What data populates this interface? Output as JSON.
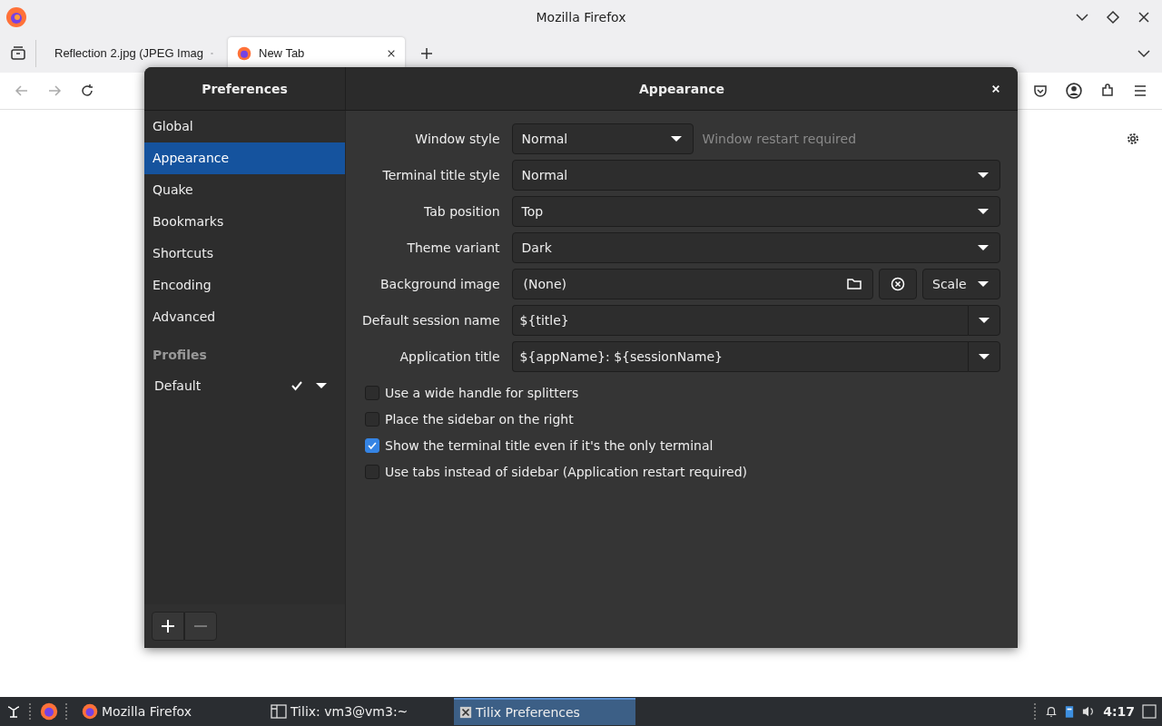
{
  "browser": {
    "title": "Mozilla Firefox",
    "tabs": [
      {
        "label": "Reflection 2.jpg (JPEG Imag",
        "selected": false
      },
      {
        "label": "New Tab",
        "selected": true
      }
    ]
  },
  "dialog": {
    "sidebar_title": "Preferences",
    "title": "Appearance",
    "sidebar": {
      "items": [
        {
          "label": "Global",
          "selected": false
        },
        {
          "label": "Appearance",
          "selected": true
        },
        {
          "label": "Quake",
          "selected": false
        },
        {
          "label": "Bookmarks",
          "selected": false
        },
        {
          "label": "Shortcuts",
          "selected": false
        },
        {
          "label": "Encoding",
          "selected": false
        },
        {
          "label": "Advanced",
          "selected": false
        }
      ],
      "profiles_heading": "Profiles",
      "profiles": [
        {
          "label": "Default",
          "checked": true
        }
      ]
    },
    "settings": [
      {
        "label": "Window style",
        "kind": "dropdown",
        "value": "Normal",
        "note": "Window restart required"
      },
      {
        "label": "Terminal title style",
        "kind": "dropdown",
        "value": "Normal"
      },
      {
        "label": "Tab position",
        "kind": "dropdown",
        "value": "Top"
      },
      {
        "label": "Theme variant",
        "kind": "dropdown",
        "value": "Dark"
      },
      {
        "label": "Background image",
        "kind": "file",
        "value": "(None)",
        "mode": "Scale"
      },
      {
        "label": "Default session name",
        "kind": "combo",
        "value": "${title}"
      },
      {
        "label": "Application title",
        "kind": "combo",
        "value": "${appName}: ${sessionName}"
      }
    ],
    "checkboxes": [
      {
        "label": "Use a wide handle for splitters",
        "checked": false
      },
      {
        "label": "Place the sidebar on the right",
        "checked": false
      },
      {
        "label": "Show the terminal title even if it's the only terminal",
        "checked": true
      },
      {
        "label": "Use tabs instead of sidebar (Application restart required)",
        "checked": false
      }
    ]
  },
  "taskbar": {
    "tasks": [
      {
        "label": "Mozilla Firefox",
        "selected": false,
        "kind": "firefox"
      },
      {
        "label": "Tilix: vm3@vm3:~",
        "selected": false,
        "kind": "terminal"
      },
      {
        "label": "Tilix Preferences",
        "selected": true,
        "kind": "tilix"
      }
    ],
    "clock": "4:17"
  }
}
